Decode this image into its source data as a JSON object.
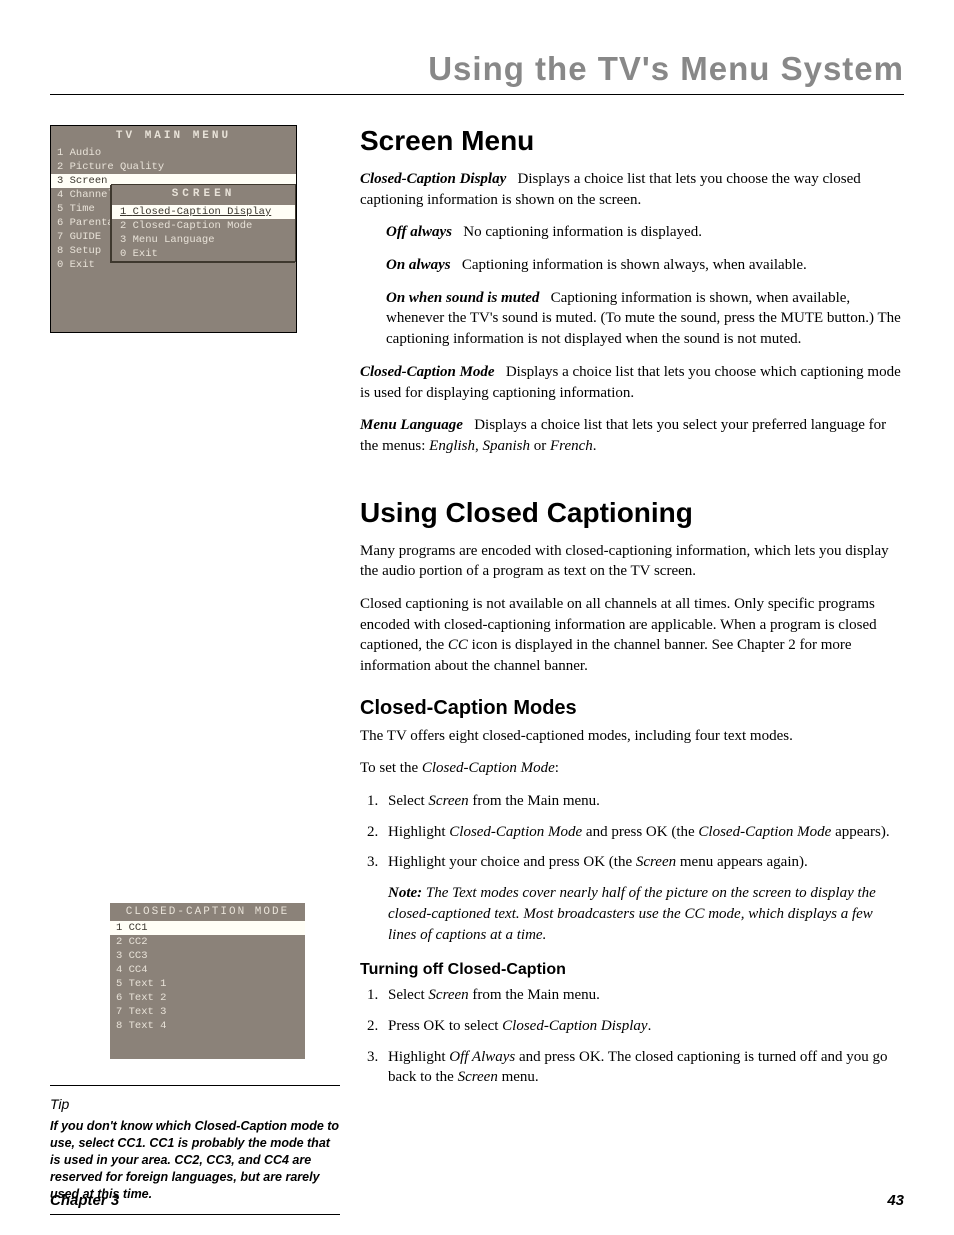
{
  "header": {
    "title": "Using the TV's Menu System"
  },
  "tvmenu": {
    "title": "TV MAIN MENU",
    "items": [
      {
        "num": "1",
        "label": "Audio"
      },
      {
        "num": "2",
        "label": "Picture Quality"
      },
      {
        "num": "3",
        "label": "Screen"
      },
      {
        "num": "4",
        "label": "Channel"
      },
      {
        "num": "5",
        "label": "Time"
      },
      {
        "num": "6",
        "label": "Parental"
      },
      {
        "num": "7",
        "label": "GUIDE"
      },
      {
        "num": "8",
        "label": "Setup"
      },
      {
        "num": "0",
        "label": "Exit"
      }
    ],
    "sub": {
      "title": "SCREEN",
      "items": [
        {
          "num": "1",
          "label": "Closed-Caption Display"
        },
        {
          "num": "2",
          "label": "Closed-Caption Mode"
        },
        {
          "num": "3",
          "label": "Menu Language"
        },
        {
          "num": "0",
          "label": "Exit"
        }
      ]
    }
  },
  "ccmenu": {
    "title": "CLOSED-CAPTION MODE",
    "items": [
      {
        "num": "1",
        "label": "CC1"
      },
      {
        "num": "2",
        "label": "CC2"
      },
      {
        "num": "3",
        "label": "CC3"
      },
      {
        "num": "4",
        "label": "CC4"
      },
      {
        "num": "5",
        "label": "Text 1"
      },
      {
        "num": "6",
        "label": "Text 2"
      },
      {
        "num": "7",
        "label": "Text 3"
      },
      {
        "num": "8",
        "label": "Text 4"
      }
    ]
  },
  "tip": {
    "label": "Tip",
    "body": "If you don't know which Closed-Caption mode to use, select CC1. CC1 is probably the mode that is used in your area. CC2, CC3, and CC4 are reserved for foreign languages, but are rarely used at this time."
  },
  "s1": {
    "h": "Screen Menu",
    "p1a": "Closed-Caption Display",
    "p1b": "Displays a choice list that lets you choose the way closed captioning information is shown on the screen.",
    "opt1a": "Off always",
    "opt1b": "No captioning information is displayed.",
    "opt2a": "On always",
    "opt2b": "Captioning information is shown always, when available.",
    "opt3a": "On when sound is muted",
    "opt3b": "Captioning information is shown, when available, whenever the TV's sound is muted. (To mute the sound, press the MUTE button.) The captioning information is not displayed when the sound is not muted.",
    "p2a": "Closed-Caption Mode",
    "p2b": "Displays a choice list that lets you choose which captioning mode is used for displaying captioning information.",
    "p3a": "Menu Language",
    "p3b1": "Displays a choice list that lets you select your preferred language for the menus: ",
    "p3b2": "English",
    "p3b3": ", ",
    "p3b4": "Spanish",
    "p3b5": " or ",
    "p3b6": "French",
    "p3b7": "."
  },
  "s2": {
    "h": "Using Closed Captioning",
    "p1": "Many programs are encoded with closed-captioning information, which lets you display the audio portion of a program as text on the TV screen.",
    "p2a": "Closed captioning is not available on all channels at all times. Only specific programs encoded with closed-captioning information are applicable. When a program is closed captioned, the ",
    "p2b": "CC",
    "p2c": " icon is displayed in the channel banner. See Chapter 2 for more information about the channel banner."
  },
  "s3": {
    "h": "Closed-Caption Modes",
    "p1": "The TV offers eight closed-captioned modes, including four text modes.",
    "p2a": "To set the ",
    "p2b": "Closed-Caption Mode",
    "p2c": ":",
    "li1a": "Select ",
    "li1b": "Screen",
    "li1c": " from the Main menu.",
    "li2a": "Highlight ",
    "li2b": "Closed-Caption Mode",
    "li2c": " and press OK  (the ",
    "li2d": "Closed-Caption Mode",
    "li2e": " appears).",
    "li3a": "Highlight your choice and press OK (the ",
    "li3b": "Screen",
    "li3c": " menu appears again).",
    "notea": "Note:",
    "noteb": " The Text modes cover nearly half of the picture on the screen to display the closed-captioned text. Most broadcasters use the CC mode, which displays a few lines of captions at a time."
  },
  "s4": {
    "h": "Turning off Closed-Caption",
    "li1a": "Select ",
    "li1b": "Screen",
    "li1c": " from the Main menu.",
    "li2a": "Press OK to select ",
    "li2b": "Closed-Caption Display",
    "li2c": ".",
    "li3a": "Highlight ",
    "li3b": "Off Always",
    "li3c": " and press OK. The closed captioning is turned off and you go back to the ",
    "li3d": "Screen",
    "li3e": " menu."
  },
  "footer": {
    "left": "Chapter 3",
    "right": "43"
  }
}
